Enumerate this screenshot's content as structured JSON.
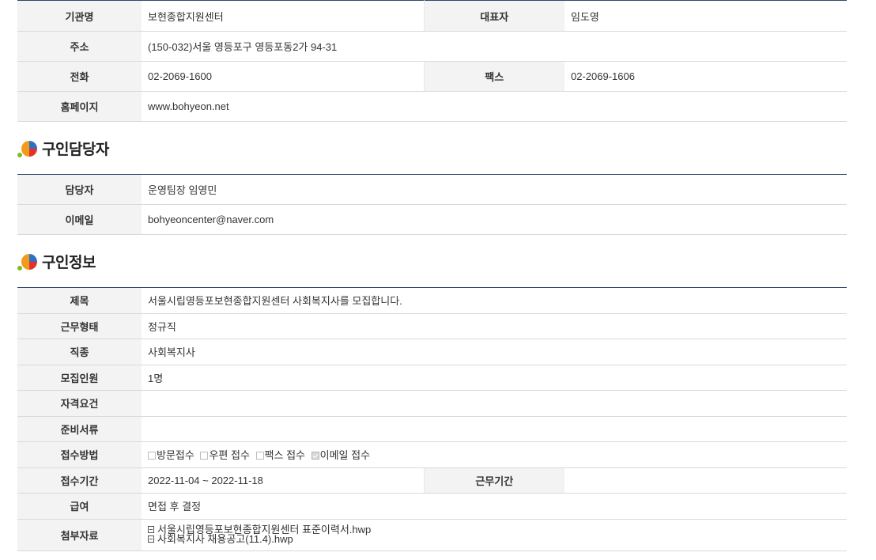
{
  "org": {
    "name_label": "기관명",
    "name": "보현종합지원센터",
    "rep_label": "대표자",
    "rep": "임도영",
    "address_label": "주소",
    "address": "(150-032)서울 영등포구 영등포동2가 94-31",
    "phone_label": "전화",
    "phone": "02-2069-1600",
    "fax_label": "팩스",
    "fax": "02-2069-1606",
    "homepage_label": "홈페이지",
    "homepage": "www.bohyeon.net"
  },
  "contact": {
    "title": "구인담당자",
    "person_label": "담당자",
    "person": "운영팀장 임영민",
    "email_label": "이메일",
    "email": "bohyeoncenter@naver.com"
  },
  "job": {
    "title": "구인정보",
    "subject_label": "제목",
    "subject": "서울시립영등포보현종합지원센터 사회복지사를 모집합니다.",
    "type_label": "근무형태",
    "type": "정규직",
    "occupation_label": "직종",
    "occupation": "사회복지사",
    "headcount_label": "모집인원",
    "headcount": "1명",
    "qualification_label": "자격요건",
    "qualification": "",
    "documents_label": "준비서류",
    "documents": "",
    "method_label": "접수방법",
    "methods": [
      {
        "label": "방문접수",
        "checked": false
      },
      {
        "label": "우편 접수",
        "checked": false
      },
      {
        "label": "팩스 접수",
        "checked": false
      },
      {
        "label": "이메일 접수",
        "checked": true
      }
    ],
    "period_label": "접수기간",
    "period": "2022-11-04 ~ 2022-11-18",
    "work_period_label": "근무기간",
    "work_period": "",
    "salary_label": "급여",
    "salary": "면접 후 결정",
    "attach_label": "첨부자료",
    "attachments": [
      "서울시립영등포보현종합지원센터 표준이력서.hwp",
      "사회복지사 채용공고(11.4).hwp"
    ]
  },
  "colors": {
    "header_bg": "#f3f3f3",
    "top_border": "#2f4a6b",
    "icon_blue": "#2f6fc4",
    "icon_orange": "#f29a1b",
    "icon_red": "#e2332b",
    "icon_green": "#7cbd2a"
  }
}
